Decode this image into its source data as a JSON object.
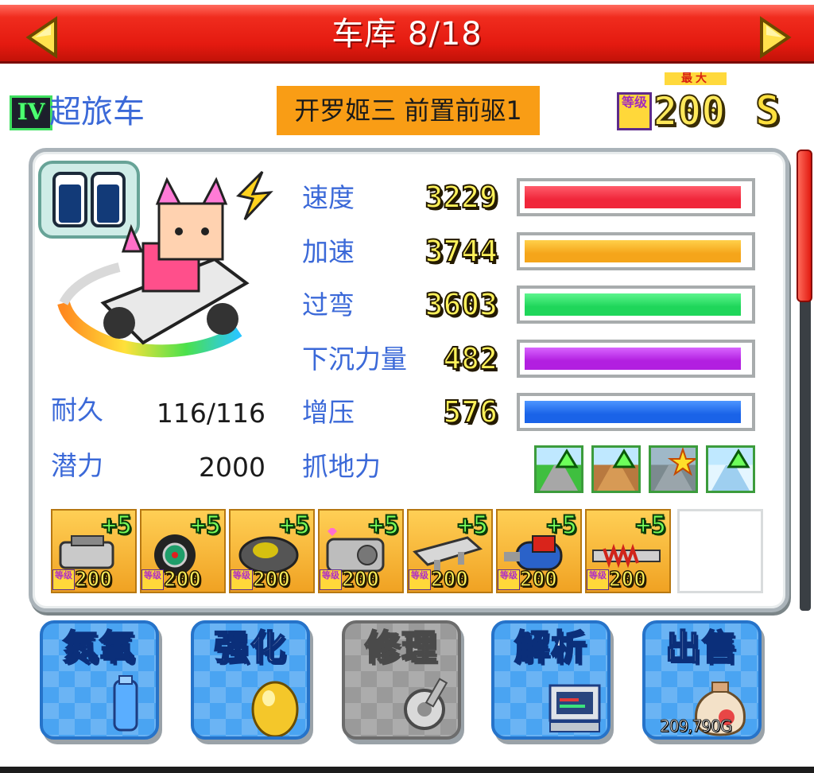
{
  "header": {
    "title": "车库 8/18",
    "prev_icon": "triangle-left-icon",
    "next_icon": "triangle-right-icon"
  },
  "car": {
    "class_badge": "IV",
    "type": "超旅车",
    "name": "开罗姬三 前置前驱1",
    "max_label": "最大",
    "level_chip": "等级",
    "level": "200",
    "rank": "S"
  },
  "stats": [
    {
      "label": "速度",
      "value": "3229",
      "fill": 0.97,
      "color": "#f0263a",
      "color2": "#ff5c6b"
    },
    {
      "label": "加速",
      "value": "3744",
      "fill": 0.97,
      "color": "#f5a51a",
      "color2": "#ffd04a"
    },
    {
      "label": "过弯",
      "value": "3603",
      "fill": 0.97,
      "color": "#1fd65a",
      "color2": "#5cf58d"
    },
    {
      "label": "下沉力量",
      "value": "482",
      "fill": 0.97,
      "color": "#b21fe0",
      "color2": "#d865ff"
    },
    {
      "label": "增压",
      "value": "576",
      "fill": 0.97,
      "color": "#1a63e8",
      "color2": "#4d95ff"
    }
  ],
  "durability": {
    "label": "耐久",
    "value": "116/116"
  },
  "potential": {
    "label": "潜力",
    "value": "2000"
  },
  "grip": {
    "label": "抓地力",
    "icons": [
      "grass-road-icon",
      "dirt-road-icon",
      "gravel-road-star-icon",
      "snow-road-icon"
    ]
  },
  "parts": [
    {
      "name": "engine-part-icon",
      "plus": "+5",
      "chip": "等级",
      "level": "200"
    },
    {
      "name": "tire-part-icon",
      "plus": "+5",
      "chip": "等级",
      "level": "200"
    },
    {
      "name": "brake-part-icon",
      "plus": "+5",
      "chip": "等级",
      "level": "200"
    },
    {
      "name": "turbo-part-icon",
      "plus": "+5",
      "chip": "等级",
      "level": "200"
    },
    {
      "name": "spoiler-part-icon",
      "plus": "+5",
      "chip": "等级",
      "level": "200"
    },
    {
      "name": "nitro-tank-part-icon",
      "plus": "+5",
      "chip": "等级",
      "level": "200"
    },
    {
      "name": "suspension-part-icon",
      "plus": "+5",
      "chip": "等级",
      "level": "200"
    }
  ],
  "actions": {
    "nitro": "氮氧",
    "upgrade": "强化",
    "repair": "修理",
    "analyze": "解析",
    "sell": "出售",
    "money": "209,790G"
  }
}
